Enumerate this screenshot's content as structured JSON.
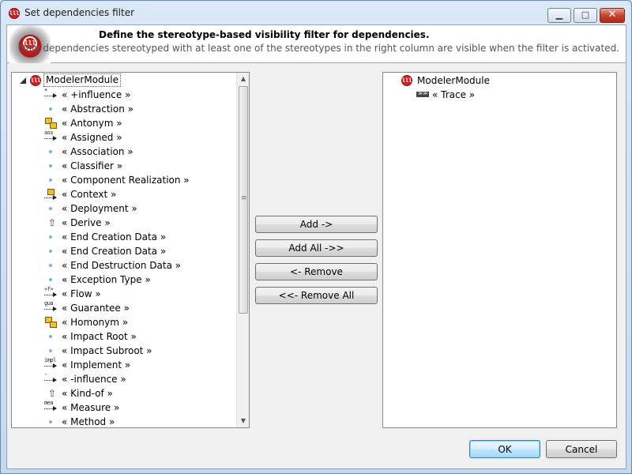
{
  "window": {
    "title": "Set dependencies filter",
    "minimize": "▁",
    "maximize": "□",
    "close": "✕"
  },
  "header": {
    "title": "Define the stereotype-based visibility filter for dependencies.",
    "subtitle": "Only dependencies stereotyped with at least one of the stereotypes in the right column are visible when the filter is activated."
  },
  "left_tree": {
    "root": "ModelerModule",
    "items": [
      {
        "label": "« +influence »",
        "icon": "dependency-arrow-icon",
        "tag": "+"
      },
      {
        "label": "« Abstraction »",
        "icon": "bullet-icon"
      },
      {
        "label": "« Antonym »",
        "icon": "antonym-icon"
      },
      {
        "label": "« Assigned »",
        "icon": "dependency-arrow-icon",
        "tag": "ass"
      },
      {
        "label": "« Association »",
        "icon": "bullet-icon"
      },
      {
        "label": "« Classifier »",
        "icon": "bullet-icon"
      },
      {
        "label": "« Component Realization »",
        "icon": "bullet-icon"
      },
      {
        "label": "« Context »",
        "icon": "context-icon"
      },
      {
        "label": "« Deployment »",
        "icon": "bullet-icon"
      },
      {
        "label": "« Derive »",
        "icon": "derive-icon"
      },
      {
        "label": "« End Creation Data »",
        "icon": "bullet-icon"
      },
      {
        "label": "« End Creation Data »",
        "icon": "bullet-icon"
      },
      {
        "label": "« End Destruction Data »",
        "icon": "bullet-icon"
      },
      {
        "label": "« Exception Type »",
        "icon": "bullet-icon"
      },
      {
        "label": "« Flow »",
        "icon": "dependency-arrow-icon",
        "tag": "«f»"
      },
      {
        "label": "« Guarantee »",
        "icon": "dependency-arrow-icon",
        "tag": "gua"
      },
      {
        "label": "« Homonym »",
        "icon": "homonym-icon"
      },
      {
        "label": "« Impact Root »",
        "icon": "bullet-icon"
      },
      {
        "label": "« Impact Subroot »",
        "icon": "bullet-icon"
      },
      {
        "label": "« Implement »",
        "icon": "dependency-arrow-icon",
        "tag": "impl"
      },
      {
        "label": "« -influence »",
        "icon": "dependency-arrow-icon",
        "tag": "-"
      },
      {
        "label": "« Kind-of »",
        "icon": "derive-icon"
      },
      {
        "label": "« Measure »",
        "icon": "dependency-arrow-icon",
        "tag": "mea"
      },
      {
        "label": "« Method »",
        "icon": "bullet-icon"
      }
    ]
  },
  "right_tree": {
    "root": "ModelerModule",
    "items": [
      {
        "label": "« Trace »",
        "icon": "trace-icon"
      }
    ]
  },
  "buttons": {
    "add": "Add ->",
    "add_all": "Add All ->>",
    "remove": "<- Remove",
    "remove_all": "<<- Remove All",
    "ok": "OK",
    "cancel": "Cancel"
  },
  "colors": {
    "accent": "#c62424",
    "bullet": "#7cb0e4"
  }
}
